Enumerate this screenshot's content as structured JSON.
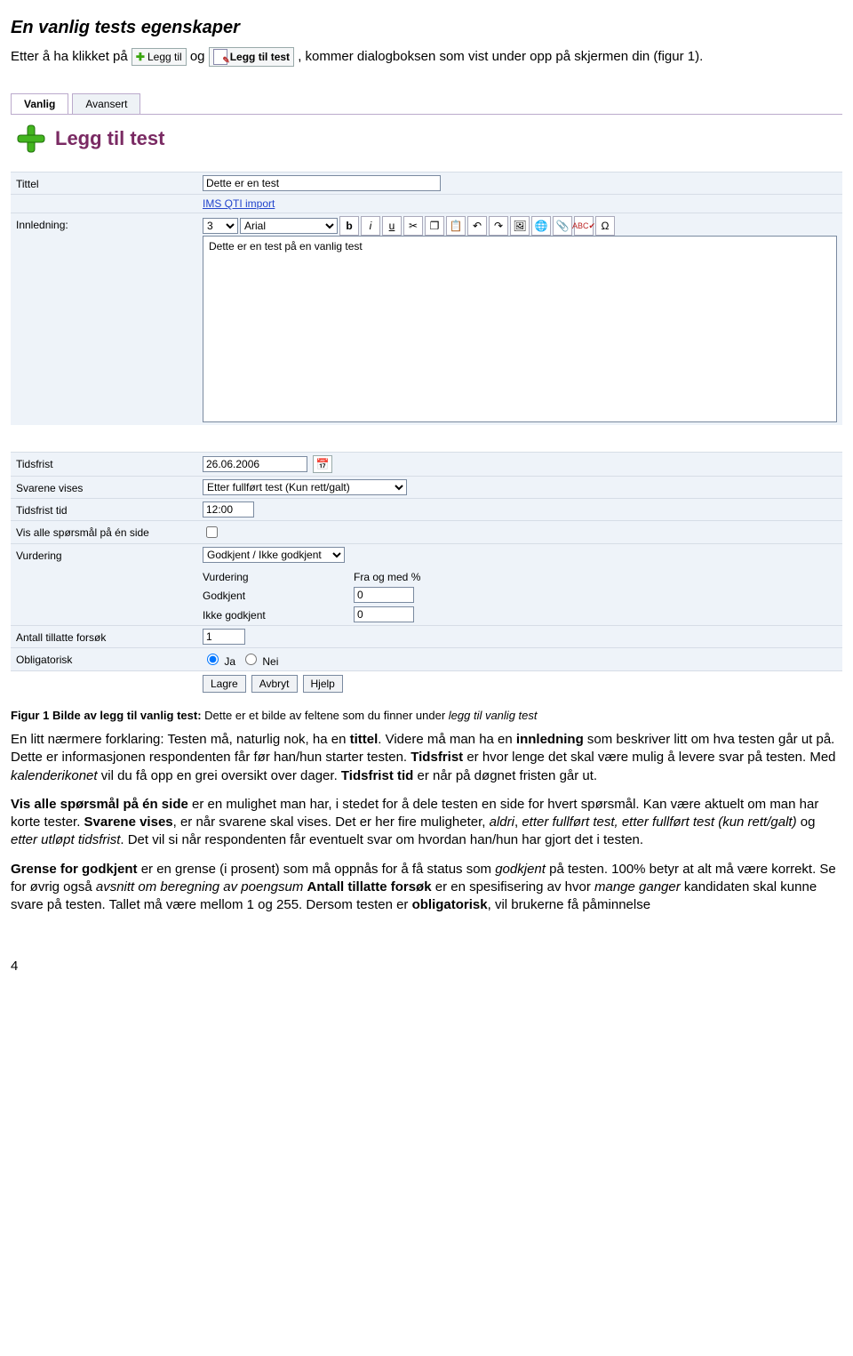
{
  "heading": "En vanlig tests egenskaper",
  "intro": {
    "before": "Etter å ha klikket på ",
    "btn1_label": "Legg til",
    "mid": " og ",
    "btn2_label": "Legg til test",
    "after": ", kommer dialogboksen som vist under opp på skjermen din (figur 1)."
  },
  "dialog": {
    "tabs": {
      "vanlig": "Vanlig",
      "avansert": "Avansert"
    },
    "title": "Legg til test",
    "labels": {
      "tittel": "Tittel",
      "innledning": "Innledning:",
      "tidsfrist": "Tidsfrist",
      "svarene": "Svarene vises",
      "tidsfrist_tid": "Tidsfrist tid",
      "vis_alle": "Vis alle spørsmål på én side",
      "vurdering": "Vurdering",
      "vurdering_col": "Vurdering",
      "fra_og_med": "Fra og med %",
      "godkjent_row": "Godkjent",
      "ikke_godkjent_row": "Ikke godkjent",
      "antall": "Antall tillatte forsøk",
      "obligatorisk": "Obligatorisk",
      "ja": "Ja",
      "nei": "Nei"
    },
    "values": {
      "tittel": "Dette er en test",
      "link_import": "IMS QTI import",
      "font_size": "3",
      "font_name": "Arial",
      "editor_text": "Dette er en test på en vanlig test",
      "tidsfrist": "26.06.2006",
      "svarene": "Etter fullført test (Kun rett/galt)",
      "tidsfrist_tid": "12:00",
      "vurdering": "Godkjent / Ikke godkjent",
      "godkjent_val": "0",
      "ikke_godkjent_val": "0",
      "antall": "1"
    },
    "buttons": {
      "lagre": "Lagre",
      "avbryt": "Avbryt",
      "hjelp": "Hjelp"
    }
  },
  "caption": "Figur 1 Bilde av legg til vanlig test: Dette er et bilde av feltene som du finner under legg til vanlig test",
  "paragraphs": {
    "p1": "En litt nærmere forklaring: Testen må, naturlig nok, ha en tittel. Videre må man ha en innledning som beskriver litt om hva testen går ut på. Dette er informasjonen respondenten får før han/hun starter testen. Tidsfrist er hvor lenge det skal være mulig å levere svar på testen. Med kalenderikonet vil du få opp en grei oversikt over dager. Tidsfrist tid er når på døgnet fristen går ut.",
    "p2": "Vis alle spørsmål på én side er en mulighet man har, i stedet for å dele testen en side for hvert spørsmål. Kan være aktuelt om man har korte tester. Svarene vises, er når svarene skal vises. Det er her fire muligheter, aldri, etter fullført test, etter fullført test (kun rett/galt) og etter utløpt tidsfrist. Det vil si når respondenten får eventuelt svar om hvordan han/hun har gjort det i testen.",
    "p3": "Grense for godkjent er en grense (i prosent) som må oppnås for å få status som godkjent på testen. 100% betyr at alt må være korrekt. Se for øvrig også avsnitt om beregning av poengsum Antall tillatte forsøk er en spesifisering av hvor mange ganger kandidaten skal kunne svare på testen. Tallet må være mellom 1 og 255. Dersom testen er obligatorisk, vil brukerne få påminnelse"
  },
  "page_number": "4"
}
